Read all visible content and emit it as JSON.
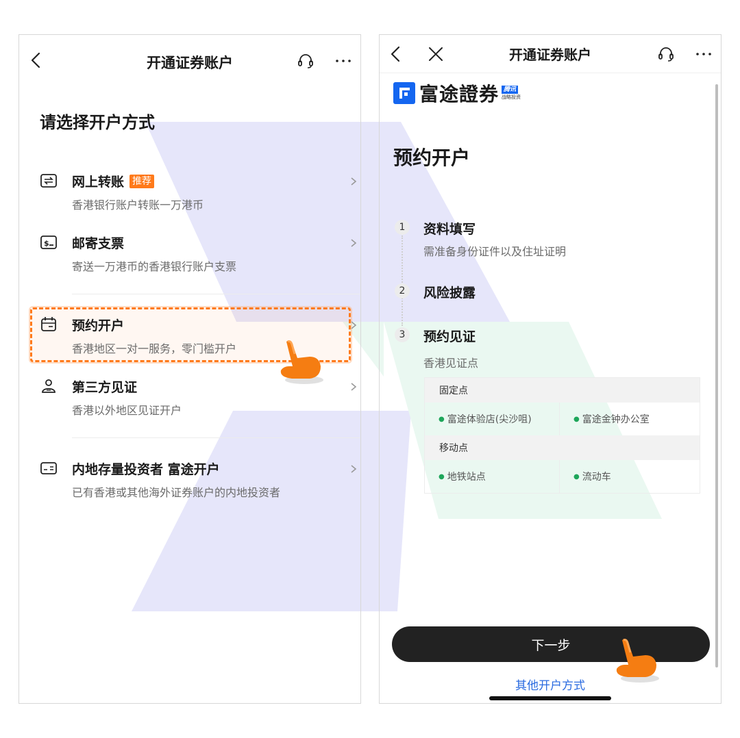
{
  "colors": {
    "accent": "#ff7a1a",
    "primary_button": "#222222",
    "link": "#2a6be0",
    "brand_blue": "#1466f0",
    "dot_green": "#1ea65a"
  },
  "left": {
    "nav": {
      "title": "开通证券账户",
      "icons": [
        "back-icon",
        "headset-icon",
        "more-icon"
      ]
    },
    "section_title": "请选择开户方式",
    "options": [
      {
        "icon": "transfer-icon",
        "title": "网上转账",
        "tag": "推荐",
        "subtitle": "香港银行账户转账一万港币"
      },
      {
        "icon": "cheque-icon",
        "title": "邮寄支票",
        "subtitle": "寄送一万港币的香港银行账户支票"
      },
      {
        "icon": "calendar-icon",
        "title": "预约开户",
        "subtitle": "香港地区一对一服务，零门槛开户",
        "highlighted": true
      },
      {
        "icon": "person-icon",
        "title": "第三方见证",
        "subtitle": "香港以外地区见证开户"
      },
      {
        "icon": "id-card-icon",
        "title": "内地存量投资者 富途开户",
        "subtitle": "已有香港或其他海外证券账户的内地投资者"
      }
    ]
  },
  "right": {
    "nav": {
      "title": "开通证券账户",
      "icons": [
        "back-icon",
        "close-icon",
        "headset-icon",
        "more-icon"
      ]
    },
    "brand": {
      "name": "富途證券",
      "badge_top": "腾讯",
      "badge_bottom": "战略投资"
    },
    "heading": "预约开户",
    "steps": [
      {
        "num": "1",
        "title": "资料填写",
        "subtitle": "需准备身份证件以及住址证明"
      },
      {
        "num": "2",
        "title": "风险披露"
      },
      {
        "num": "3",
        "title": "预约见证",
        "subtitle": "香港见证点"
      }
    ],
    "points": {
      "fixed_label": "固定点",
      "fixed": [
        "富途体验店(尖沙咀)",
        "富途金钟办公室"
      ],
      "mobile_label": "移动点",
      "mobile": [
        "地铁站点",
        "流动车"
      ]
    },
    "next_button": "下一步",
    "other_link": "其他开户方式"
  }
}
